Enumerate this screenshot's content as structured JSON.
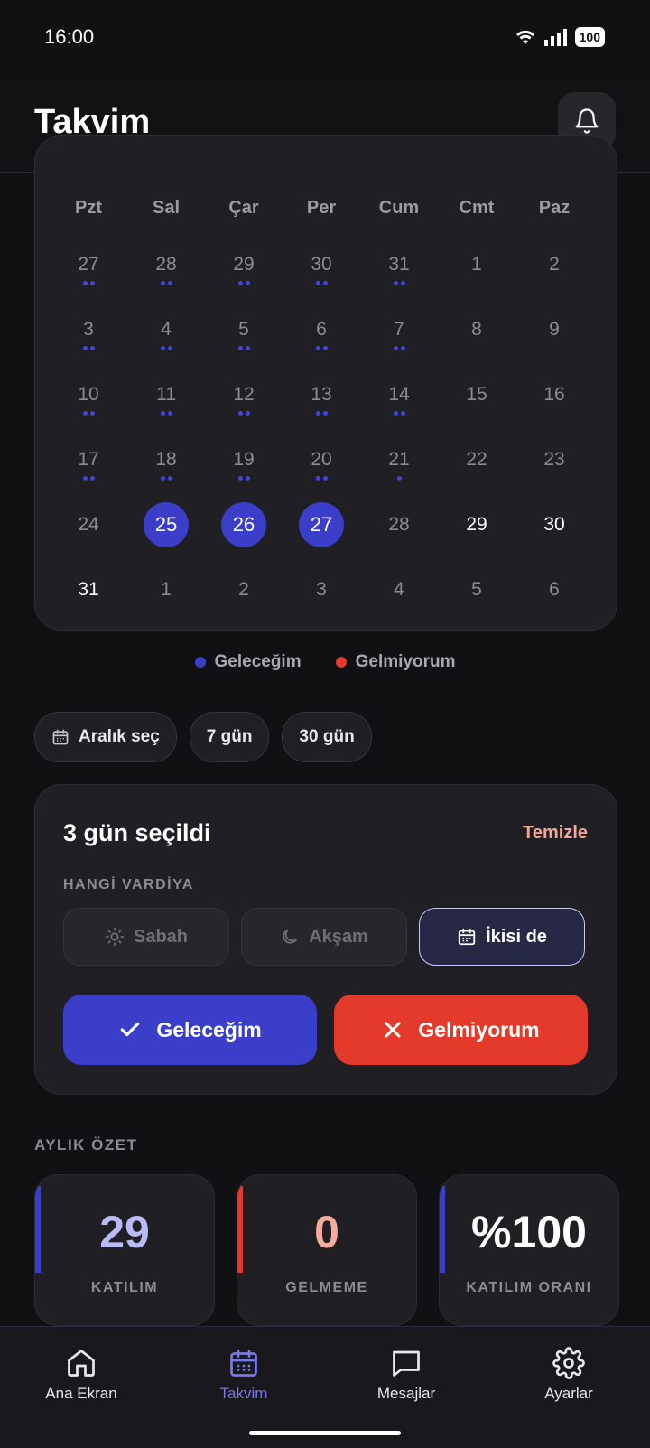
{
  "status": {
    "time": "16:00",
    "battery": "100"
  },
  "header": {
    "title": "Takvim"
  },
  "calendar": {
    "weekdays": [
      "Pzt",
      "Sal",
      "Çar",
      "Per",
      "Cum",
      "Cmt",
      "Paz"
    ],
    "weeks": [
      [
        {
          "d": "27",
          "dots": 2
        },
        {
          "d": "28",
          "dots": 2
        },
        {
          "d": "29",
          "dots": 2
        },
        {
          "d": "30",
          "dots": 2
        },
        {
          "d": "31",
          "dots": 2
        },
        {
          "d": "1",
          "dots": 0
        },
        {
          "d": "2",
          "dots": 0
        }
      ],
      [
        {
          "d": "3",
          "dots": 2
        },
        {
          "d": "4",
          "dots": 2
        },
        {
          "d": "5",
          "dots": 2
        },
        {
          "d": "6",
          "dots": 2
        },
        {
          "d": "7",
          "dots": 2
        },
        {
          "d": "8",
          "dots": 0
        },
        {
          "d": "9",
          "dots": 0
        }
      ],
      [
        {
          "d": "10",
          "dots": 2
        },
        {
          "d": "11",
          "dots": 2
        },
        {
          "d": "12",
          "dots": 2
        },
        {
          "d": "13",
          "dots": 2
        },
        {
          "d": "14",
          "dots": 2
        },
        {
          "d": "15",
          "dots": 0
        },
        {
          "d": "16",
          "dots": 0
        }
      ],
      [
        {
          "d": "17",
          "dots": 2
        },
        {
          "d": "18",
          "dots": 2
        },
        {
          "d": "19",
          "dots": 2
        },
        {
          "d": "20",
          "dots": 2
        },
        {
          "d": "21",
          "dots": 1
        },
        {
          "d": "22",
          "dots": 0
        },
        {
          "d": "23",
          "dots": 0
        }
      ],
      [
        {
          "d": "24",
          "dots": 0
        },
        {
          "d": "25",
          "dots": 0,
          "selected": true
        },
        {
          "d": "26",
          "dots": 0,
          "selected": true
        },
        {
          "d": "27",
          "dots": 0,
          "selected": true
        },
        {
          "d": "28",
          "dots": 0
        },
        {
          "d": "29",
          "dots": 0,
          "current": true
        },
        {
          "d": "30",
          "dots": 0,
          "current": true
        }
      ],
      [
        {
          "d": "31",
          "dots": 0,
          "current": true
        },
        {
          "d": "1",
          "dots": 0
        },
        {
          "d": "2",
          "dots": 0
        },
        {
          "d": "3",
          "dots": 0
        },
        {
          "d": "4",
          "dots": 0
        },
        {
          "d": "5",
          "dots": 0
        },
        {
          "d": "6",
          "dots": 0
        }
      ]
    ]
  },
  "legend": {
    "coming": "Geleceğim",
    "not_coming": "Gelmiyorum",
    "coming_color": "#3b3ec8",
    "not_coming_color": "#e43a2c"
  },
  "range_chips": {
    "pick": "Aralık seç",
    "seven": "7 gün",
    "thirty": "30 gün"
  },
  "selection": {
    "title": "3 gün seçildi",
    "clear": "Temizle",
    "shift_label": "HANGİ VARDİYA",
    "shift_morning": "Sabah",
    "shift_evening": "Akşam",
    "shift_both": "İkisi de",
    "btn_coming": "Geleceğim",
    "btn_not_coming": "Gelmiyorum"
  },
  "summary": {
    "label": "AYLIK ÖZET",
    "attendance_value": "29",
    "attendance_label": "KATILIM",
    "absence_value": "0",
    "absence_label": "GELMEME",
    "rate_value": "%100",
    "rate_label": "KATILIM ORANI"
  },
  "tabs": {
    "home": "Ana Ekran",
    "calendar": "Takvim",
    "messages": "Mesajlar",
    "settings": "Ayarlar"
  }
}
